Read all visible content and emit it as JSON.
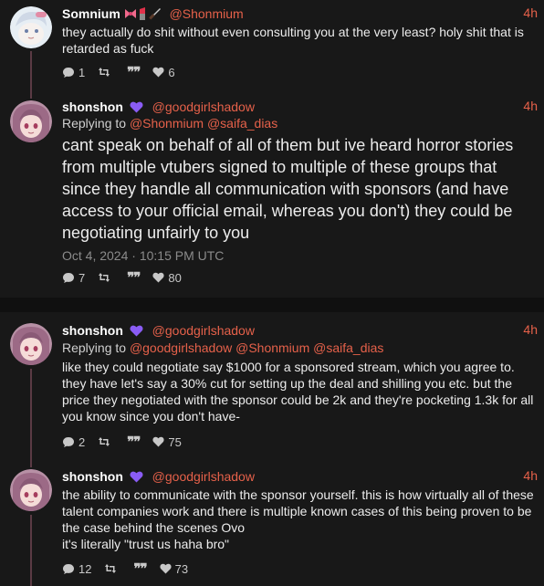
{
  "tweets": [
    {
      "name": "Somnium",
      "emojis": [
        "ribbon-emoji",
        "lipstick-emoji",
        "knife-emoji"
      ],
      "handle": "@Shonmium",
      "time": "4h",
      "text": "they actually do shit without even consulting you at the very least? holy shit that is retarded as fuck",
      "stats": {
        "replies": "1",
        "retweets": "",
        "quotes": "",
        "likes": "6"
      }
    },
    {
      "name": "shonshon",
      "handle": "@goodgirlshadow",
      "time": "4h",
      "replying_label": "Replying to",
      "replying_to": "@Shonmium @saifa_dias",
      "text": "cant speak on behalf of all of them but ive heard horror stories from multiple vtubers signed to multiple of these groups that since they handle all communication with sponsors (and have access to your official email, whereas you don't) they could be negotiating unfairly to you",
      "date": "Oct 4, 2024 · 10:15 PM UTC",
      "stats": {
        "replies": "7",
        "retweets": "",
        "quotes": "",
        "likes": "80"
      }
    },
    {
      "name": "shonshon",
      "handle": "@goodgirlshadow",
      "time": "4h",
      "replying_label": "Replying to",
      "replying_to": "@goodgirlshadow @Shonmium @saifa_dias",
      "text": "like they could negotiate say $1000 for a sponsored stream, which you agree to. they have let's say a 30% cut for setting up the deal and shilling you etc. but the price they negotiated with the sponsor could be 2k and they're pocketing 1.3k for all you know since you don't have-",
      "stats": {
        "replies": "2",
        "retweets": "",
        "quotes": "",
        "likes": "75"
      }
    },
    {
      "name": "shonshon",
      "handle": "@goodgirlshadow",
      "time": "4h",
      "text_lines": [
        "the ability to communicate with the sponsor yourself. this is how virtually all of these talent companies work and there is multiple known cases of this being proven to be the case behind the scenes Ovo",
        "it's literally \"trust us haha bro\""
      ],
      "stats": {
        "replies": "12",
        "retweets": "",
        "quotes": "",
        "likes": "73"
      }
    }
  ],
  "colors": {
    "accent": "#e6614a",
    "verified_heart": "#8a5cf5",
    "background": "#181818"
  }
}
